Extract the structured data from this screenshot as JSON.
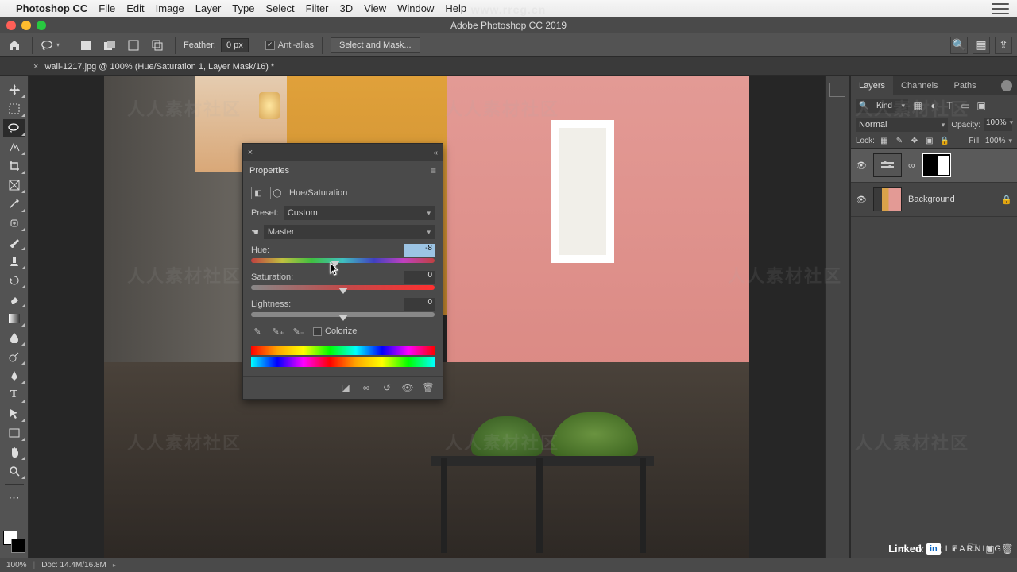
{
  "menubar": {
    "app": "Photoshop CC",
    "items": [
      "File",
      "Edit",
      "Image",
      "Layer",
      "Type",
      "Select",
      "Filter",
      "3D",
      "View",
      "Window",
      "Help"
    ]
  },
  "window": {
    "title": "Adobe Photoshop CC 2019"
  },
  "options_bar": {
    "feather_label": "Feather:",
    "feather_value": "0 px",
    "antialias_label": "Anti-alias",
    "select_mask_btn": "Select and Mask..."
  },
  "doc_tab": {
    "title": "wall-1217.jpg @ 100% (Hue/Saturation 1, Layer Mask/16) *"
  },
  "panels": {
    "tabs": [
      "Layers",
      "Channels",
      "Paths"
    ],
    "filter_kind": "Kind",
    "blend_mode": "Normal",
    "opacity_label": "Opacity:",
    "opacity_value": "100%",
    "lock_label": "Lock:",
    "fill_label": "Fill:",
    "fill_value": "100%",
    "layers": [
      {
        "name": "",
        "type": "adjustment"
      },
      {
        "name": "Background",
        "locked": true
      }
    ]
  },
  "properties": {
    "panel_title": "Properties",
    "adj_name": "Hue/Saturation",
    "preset_label": "Preset:",
    "preset_value": "Custom",
    "channel_value": "Master",
    "hue_label": "Hue:",
    "hue_value": "-8",
    "saturation_label": "Saturation:",
    "saturation_value": "0",
    "lightness_label": "Lightness:",
    "lightness_value": "0",
    "colorize_label": "Colorize"
  },
  "status": {
    "zoom": "100%",
    "doc_label": "Doc: 14.4M/16.8M"
  },
  "watermark": {
    "url": "www.rrcg.cn",
    "text": "人人素材社区"
  },
  "brand": {
    "linked": "Linked",
    "in": "in",
    "learning": "LEARNING"
  }
}
